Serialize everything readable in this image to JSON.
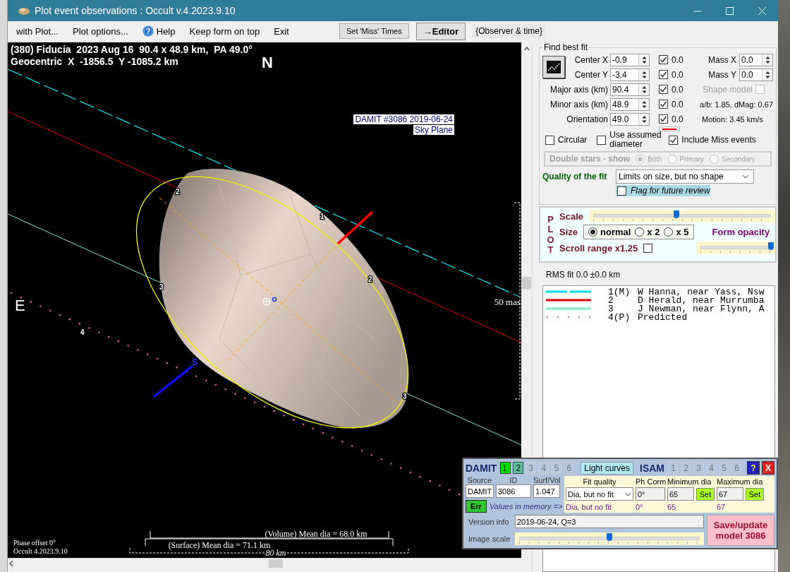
{
  "window": {
    "title": "Plot event observations : Occult v.4.2023.9.10"
  },
  "menu": [
    {
      "label": "with Plot...",
      "kind": "text"
    },
    {
      "label": "Plot options...",
      "kind": "text"
    },
    {
      "label": "Help",
      "kind": "help",
      "icon_text": "?"
    },
    {
      "label": "Keep form on top",
      "kind": "text"
    },
    {
      "label": "Exit",
      "kind": "text"
    }
  ],
  "toolbar": {
    "miss_button": "Set 'Miss' Times",
    "editor_button": "→Editor",
    "observer_label": "{Observer & time}"
  },
  "plot": {
    "header_lines": [
      "(380) Fiducia  2023 Aug 16  90.4 x 48.9 km,  PA 49.0°",
      "Geocentric  X  -1856.5  Y -1085.2 km"
    ],
    "north": "N",
    "east": "E",
    "south": "S",
    "model_caption": [
      "DAMIT #3086 2019-06-24",
      "Sky Plane"
    ],
    "scale_label": "50 mas",
    "chords": [
      {
        "labels": [
          "1"
        ]
      },
      {
        "labels": [
          "2",
          "2"
        ]
      },
      {
        "labels": [
          "3",
          "3"
        ]
      },
      {
        "labels": [
          "4"
        ]
      }
    ],
    "phase_text": "Phase offset 0°",
    "version_text": "Occult 4.2023.9.10",
    "volume_text": "(Volume) Mean dia = 68.0 km",
    "surface_text": "(Surface) Mean dia = 71.1 km",
    "km_bar_text": "80 km"
  },
  "find_best_fit": {
    "title": "Find best fit",
    "params": [
      {
        "label": "Center X",
        "value": "-0.9",
        "checked": true,
        "uncertainty": "0.0"
      },
      {
        "label": "Center Y",
        "value": "-3.4",
        "checked": true,
        "uncertainty": "0.0"
      },
      {
        "label": "Major axis (km)",
        "value": "90.4",
        "checked": true,
        "uncertainty": "0.0"
      },
      {
        "label": "Minor axis (km)",
        "value": "48.9",
        "checked": true,
        "uncertainty": "0.0"
      },
      {
        "label": "Orientation",
        "value": "49.0",
        "checked": true,
        "uncertainty": "0.0"
      }
    ],
    "mass": [
      {
        "label": "Mass X",
        "value": "0.0"
      },
      {
        "label": "Mass Y",
        "value": "0.0"
      }
    ],
    "shape_model": {
      "label": "Shape model",
      "checked": false,
      "disabled": true
    },
    "ratio_text": "a/b: 1.85, dMag: 0.67",
    "motion_text": "Motion: 3.45 km/s",
    "options": [
      {
        "label": "Circular",
        "checked": false
      },
      {
        "label": "Use assumed diameter",
        "checked": false
      },
      {
        "label": "Include Miss events",
        "checked": true
      }
    ],
    "double_stars": {
      "label": "Double stars - show",
      "disabled": true,
      "options": [
        {
          "label": "Both",
          "selected": true
        },
        {
          "label": "Primary",
          "selected": false
        },
        {
          "label": "Secondary",
          "selected": false
        }
      ]
    },
    "quality": {
      "label": "Quality of the fit",
      "value": "Limits on size, but no shape"
    },
    "flag": {
      "label": "Flag for future review",
      "checked": false
    }
  },
  "plot_panel": {
    "title": "PLOT",
    "scale": {
      "label": "Scale",
      "level": 0.47
    },
    "size": {
      "label": "Size",
      "options": [
        {
          "label": "normal",
          "selected": true
        },
        {
          "label": "x 2",
          "selected": false
        },
        {
          "label": "x 5",
          "selected": false
        }
      ]
    },
    "form_opacity": {
      "label": "Form opacity",
      "level": 1.0
    },
    "scroll_range": {
      "label": "Scroll range x1.25",
      "checked": false
    }
  },
  "rms_text": "RMS fit 0.0 ±0.0 km",
  "legend": [
    {
      "kind": "dashed",
      "color": "#00e0e8",
      "number": "1(M)",
      "name": "W Hanna, near Yass, Nsw"
    },
    {
      "kind": "solid",
      "color": "#e00000",
      "number": "2",
      "name": "D Herald, near Murrumba"
    },
    {
      "kind": "solid",
      "color": "#80e8c8",
      "number": "3",
      "name": "J Newman, near Flynn, A"
    },
    {
      "kind": "dotted",
      "color": "#e0609a",
      "number": "4(P)",
      "name": "Predicted"
    }
  ],
  "damit": {
    "title": "DAMIT",
    "models": [
      {
        "label": "1",
        "selected": true,
        "disabled": false
      },
      {
        "label": "2",
        "selected": false,
        "disabled": false
      },
      {
        "label": "3",
        "selected": false,
        "disabled": true
      },
      {
        "label": "4",
        "selected": false,
        "disabled": true
      },
      {
        "label": "5",
        "selected": false,
        "disabled": true
      },
      {
        "label": "6",
        "selected": false,
        "disabled": true
      }
    ],
    "light_curves": "Light curves",
    "isam_title": "ISAM",
    "isam_models": [
      {
        "label": "1",
        "selected": false,
        "disabled": true
      },
      {
        "label": "2",
        "selected": false,
        "disabled": true
      },
      {
        "label": "3",
        "selected": false,
        "disabled": true
      },
      {
        "label": "4",
        "selected": false,
        "disabled": true
      },
      {
        "label": "5",
        "selected": false,
        "disabled": true
      },
      {
        "label": "6",
        "selected": false,
        "disabled": true
      }
    ],
    "help": "?",
    "close": "X",
    "source_headers": [
      "Source",
      "ID",
      "Surf/Vol"
    ],
    "source_values": [
      "DAMIT",
      "3086",
      "1.047"
    ],
    "err_button": "Err",
    "memory_label": "Values in memory =>",
    "fit_headers": [
      "Fit quality",
      "Ph Corm",
      "Minimum dia",
      "Maximum dia"
    ],
    "fit_quality": "Dia, but no fit",
    "ph_corr": "0°",
    "min_dia": "65",
    "max_dia": "67",
    "set_buttons": [
      "Set",
      "Set"
    ],
    "memory_values": [
      "Dia, but no fit",
      "0°",
      "65",
      "67"
    ],
    "version_label": "Version info",
    "version_value": "2019-06-24, Q=3",
    "image_scale": {
      "label": "Image scale",
      "level": 0.5
    },
    "save_button": "Save/update model 3086"
  }
}
